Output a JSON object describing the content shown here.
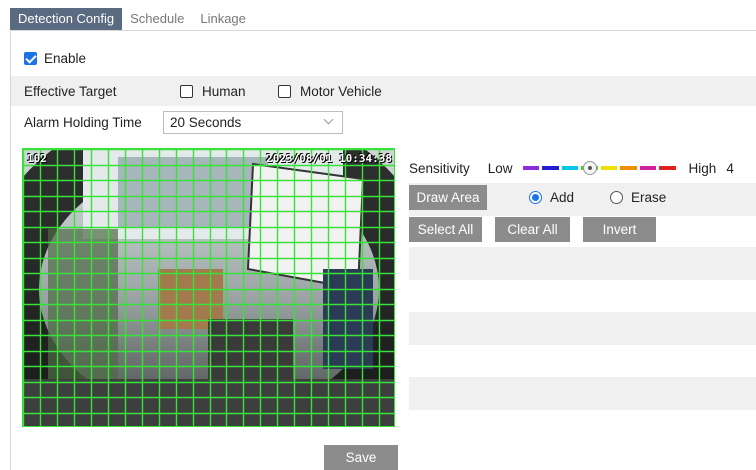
{
  "tabs": [
    {
      "label": "Detection Config",
      "active": true
    },
    {
      "label": "Schedule",
      "active": false
    },
    {
      "label": "Linkage",
      "active": false
    }
  ],
  "enable": {
    "label": "Enable",
    "checked": true
  },
  "effective_target": {
    "label": "Effective Target",
    "options": [
      {
        "label": "Human",
        "checked": false
      },
      {
        "label": "Motor Vehicle",
        "checked": false
      }
    ]
  },
  "alarm_holding": {
    "label": "Alarm Holding Time",
    "value": "20 Seconds"
  },
  "video": {
    "channel": "102",
    "timestamp": "2023/08/01 10:34:38",
    "grid_color": "#39e239"
  },
  "sensitivity": {
    "label": "Sensitivity",
    "low_label": "Low",
    "high_label": "High",
    "value": "4",
    "colors": [
      "#8a2be2",
      "#2020d0",
      "#00c8e8",
      "#40d040",
      "#f0e000",
      "#f09000",
      "#d020a0",
      "#e02020"
    ]
  },
  "area": {
    "draw_label": "Draw Area",
    "add_label": "Add",
    "erase_label": "Erase",
    "mode": "add",
    "select_all_label": "Select All",
    "clear_all_label": "Clear All",
    "invert_label": "Invert"
  },
  "save_label": "Save"
}
